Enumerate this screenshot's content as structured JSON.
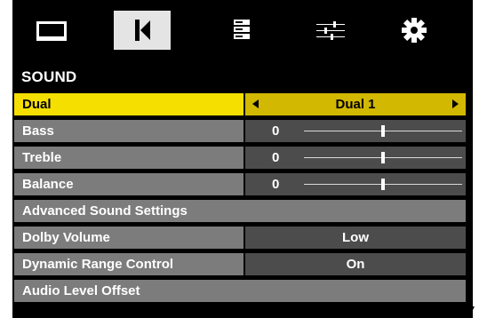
{
  "tabs": [
    {
      "icon": "picture-icon",
      "active": false
    },
    {
      "icon": "sound-icon",
      "active": true
    },
    {
      "icon": "channel-list-icon",
      "active": false
    },
    {
      "icon": "setup-sliders-icon",
      "active": false
    },
    {
      "icon": "gear-icon",
      "active": false
    }
  ],
  "section_title": "SOUND",
  "menu": [
    {
      "label": "Dual",
      "value": "Dual 1",
      "selected": true
    },
    {
      "label": "Bass",
      "value": "0",
      "level": 0.5
    },
    {
      "label": "Treble",
      "value": "0",
      "level": 0.5
    },
    {
      "label": "Balance",
      "value": "0",
      "level": 0.5
    },
    {
      "label": "Advanced Sound Settings"
    },
    {
      "label": "Dolby Volume",
      "value": "Low"
    },
    {
      "label": "Dynamic Range Control",
      "value": "On"
    },
    {
      "label": "Audio Level Offset"
    }
  ],
  "colors": {
    "selected_label": "#f5df00",
    "selected_value": "#d2b800",
    "row_label": "#7c7c7c",
    "row_value": "#4c4c4c",
    "background": "#000000"
  }
}
